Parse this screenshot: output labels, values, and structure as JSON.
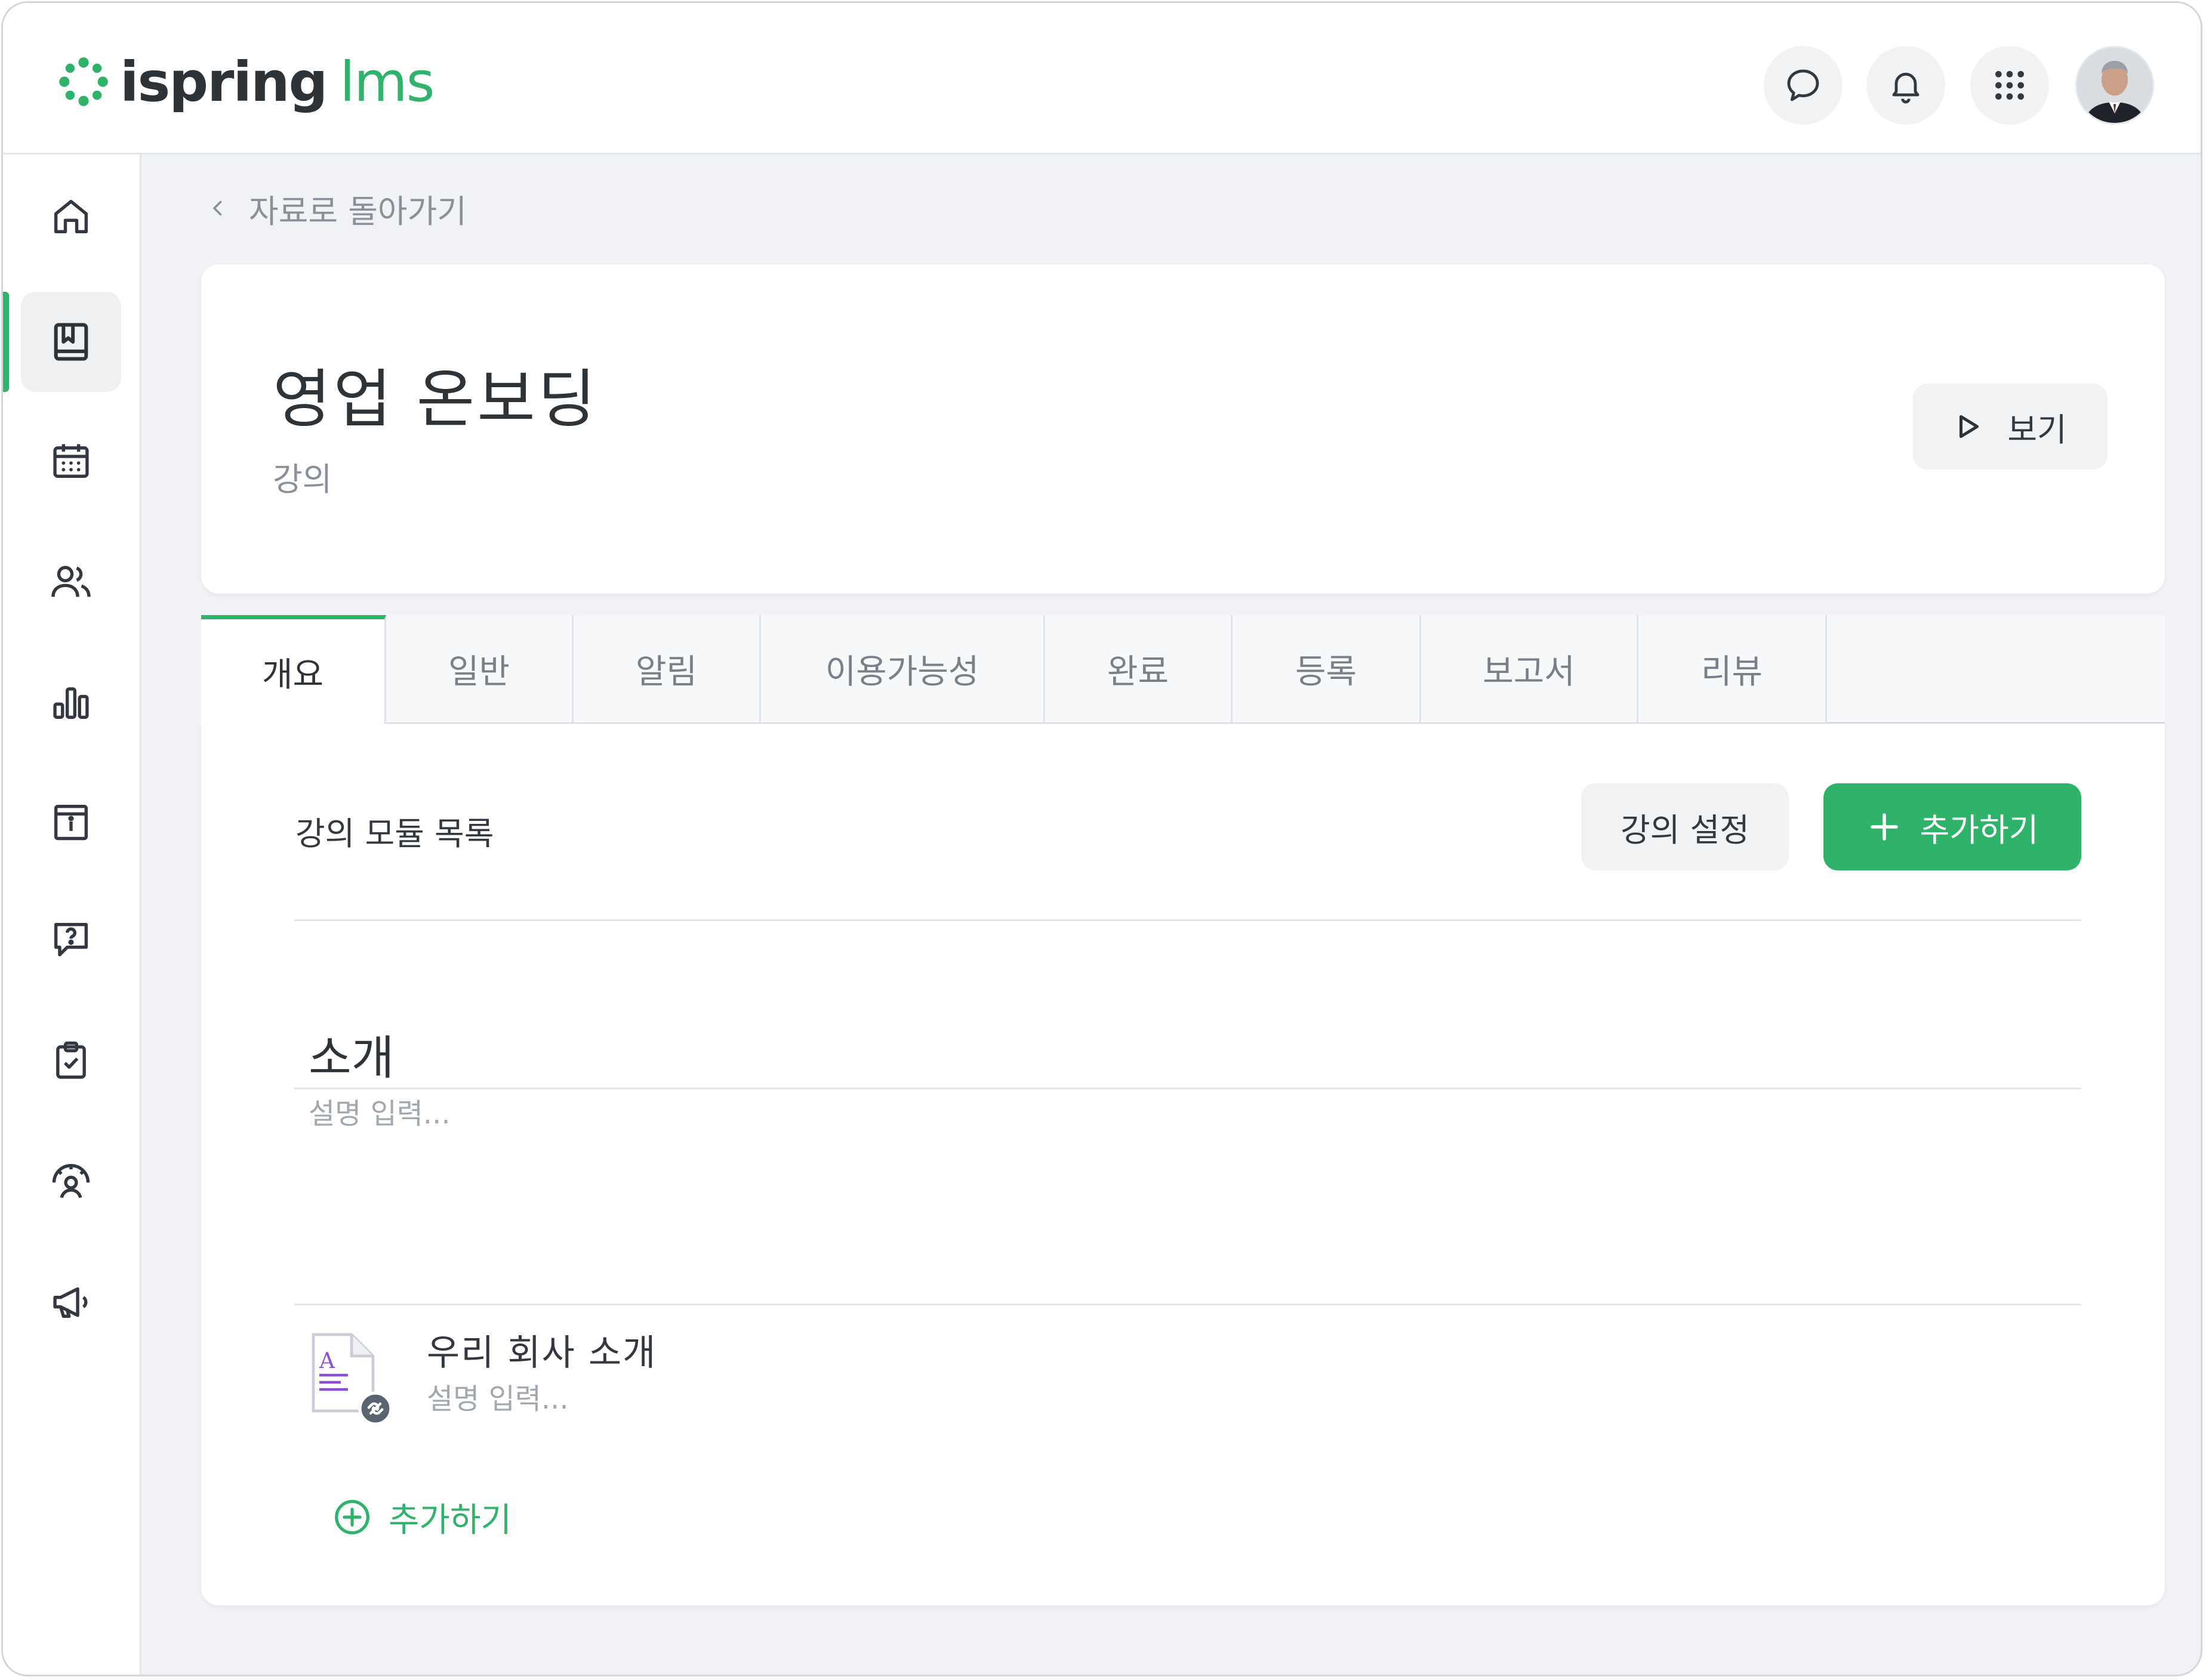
{
  "app": {
    "logo_primary": "ispring",
    "logo_secondary": "lms",
    "brand_color": "#2fb36b"
  },
  "header": {
    "icons": [
      "chat-icon",
      "bell-icon",
      "apps-grid-icon"
    ],
    "avatar": "user-avatar"
  },
  "sidebar": {
    "items": [
      {
        "icon": "home-icon",
        "active": false
      },
      {
        "icon": "book-icon",
        "active": true
      },
      {
        "icon": "calendar-icon",
        "active": false
      },
      {
        "icon": "users-icon",
        "active": false
      },
      {
        "icon": "bar-chart-icon",
        "active": false
      },
      {
        "icon": "info-board-icon",
        "active": false
      },
      {
        "icon": "question-chat-icon",
        "active": false
      },
      {
        "icon": "clipboard-check-icon",
        "active": false
      },
      {
        "icon": "user-gauge-icon",
        "active": false
      },
      {
        "icon": "megaphone-icon",
        "active": false
      }
    ]
  },
  "breadcrumb": {
    "back_label": "자료로 돌아가기"
  },
  "course": {
    "title": "영업 온보딩",
    "type": "강의",
    "view_label": "보기"
  },
  "tabs": [
    {
      "label": "개요",
      "active": true
    },
    {
      "label": "일반",
      "active": false
    },
    {
      "label": "알림",
      "active": false
    },
    {
      "label": "이용가능성",
      "active": false
    },
    {
      "label": "완료",
      "active": false
    },
    {
      "label": "등록",
      "active": false
    },
    {
      "label": "보고서",
      "active": false
    },
    {
      "label": "리뷰",
      "active": false
    }
  ],
  "content": {
    "list_title": "강의 모듈 목록",
    "settings_label": "강의 설정",
    "add_label": "추가하기",
    "section": {
      "title": "소개",
      "description_placeholder": "설명 입력..."
    },
    "modules": [
      {
        "title": "우리 회사 소개",
        "description_placeholder": "설명 입력..."
      }
    ],
    "add_item_label": "추가하기"
  }
}
